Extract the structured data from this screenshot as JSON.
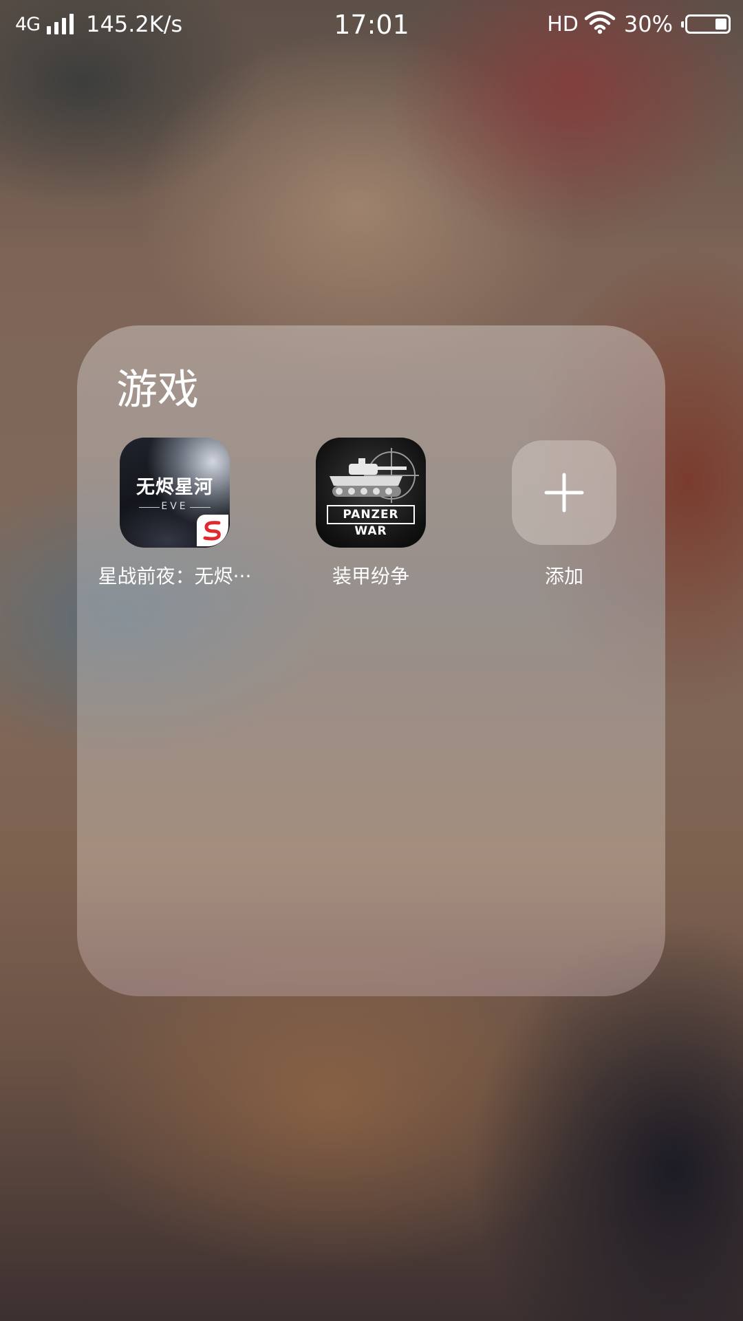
{
  "status_bar": {
    "network_type": "4G",
    "net_speed": "145.2K/s",
    "time": "17:01",
    "hd_label": "HD",
    "battery_percent": "30%",
    "battery_level": 0.3,
    "icons": [
      "signal-icon",
      "wifi-icon",
      "battery-icon"
    ]
  },
  "folder": {
    "title": "游戏",
    "apps": [
      {
        "label": "星战前夜：无烬···",
        "icon_text": "无烬星河",
        "icon_subtext": "EVE",
        "icon": "eve-app-icon"
      },
      {
        "label": "装甲纷争",
        "icon_text": "PANZER WAR",
        "icon": "panzer-war-app-icon"
      }
    ],
    "add": {
      "label": "添加",
      "icon": "plus-icon"
    }
  }
}
